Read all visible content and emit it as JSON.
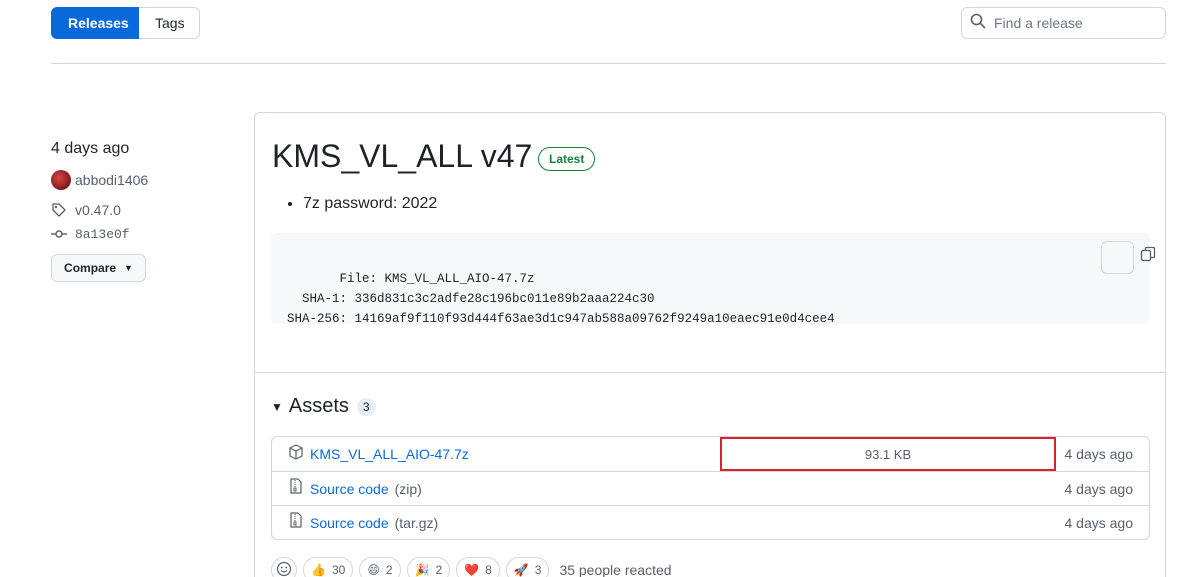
{
  "nav": {
    "releases_label": "Releases",
    "tags_label": "Tags"
  },
  "search": {
    "placeholder": "Find a release",
    "icon": "search-icon"
  },
  "meta": {
    "date": "4 days ago",
    "author": "abbodi1406",
    "tag": "v0.47.0",
    "commit": "8a13e0f",
    "compare_label": "Compare"
  },
  "release": {
    "title": "KMS_VL_ALL v47",
    "badge": "Latest",
    "notes": [
      "7z password: 2022"
    ],
    "code": "   File: KMS_VL_ALL_AIO-47.7z\n  SHA-1: 336d831c3c2adfe28c196bc011e89b2aaa224c30\nSHA-256: 14169af9f110f93d444f63ae3d1c947ab588a09762f9249a10eaec91e0d4cee4"
  },
  "assets": {
    "label": "Assets",
    "count": "3",
    "items": [
      {
        "name": "KMS_VL_ALL_AIO-47.7z",
        "suffix": "",
        "size": "93.1 KB",
        "date": "4 days ago"
      },
      {
        "name": "Source code",
        "suffix": "(zip)",
        "size": "",
        "date": "4 days ago"
      },
      {
        "name": "Source code",
        "suffix": "(tar.gz)",
        "size": "",
        "date": "4 days ago"
      }
    ]
  },
  "reactions": {
    "items": [
      {
        "emoji": "👍",
        "count": "30"
      },
      {
        "emoji": "😄",
        "count": "2"
      },
      {
        "emoji": "🎉",
        "count": "2"
      },
      {
        "emoji": "❤️",
        "count": "8"
      },
      {
        "emoji": "🚀",
        "count": "3"
      }
    ],
    "summary": "35 people reacted"
  },
  "colors": {
    "accent": "#0969da",
    "success": "#1a7f37",
    "highlight": "#d9232d"
  }
}
